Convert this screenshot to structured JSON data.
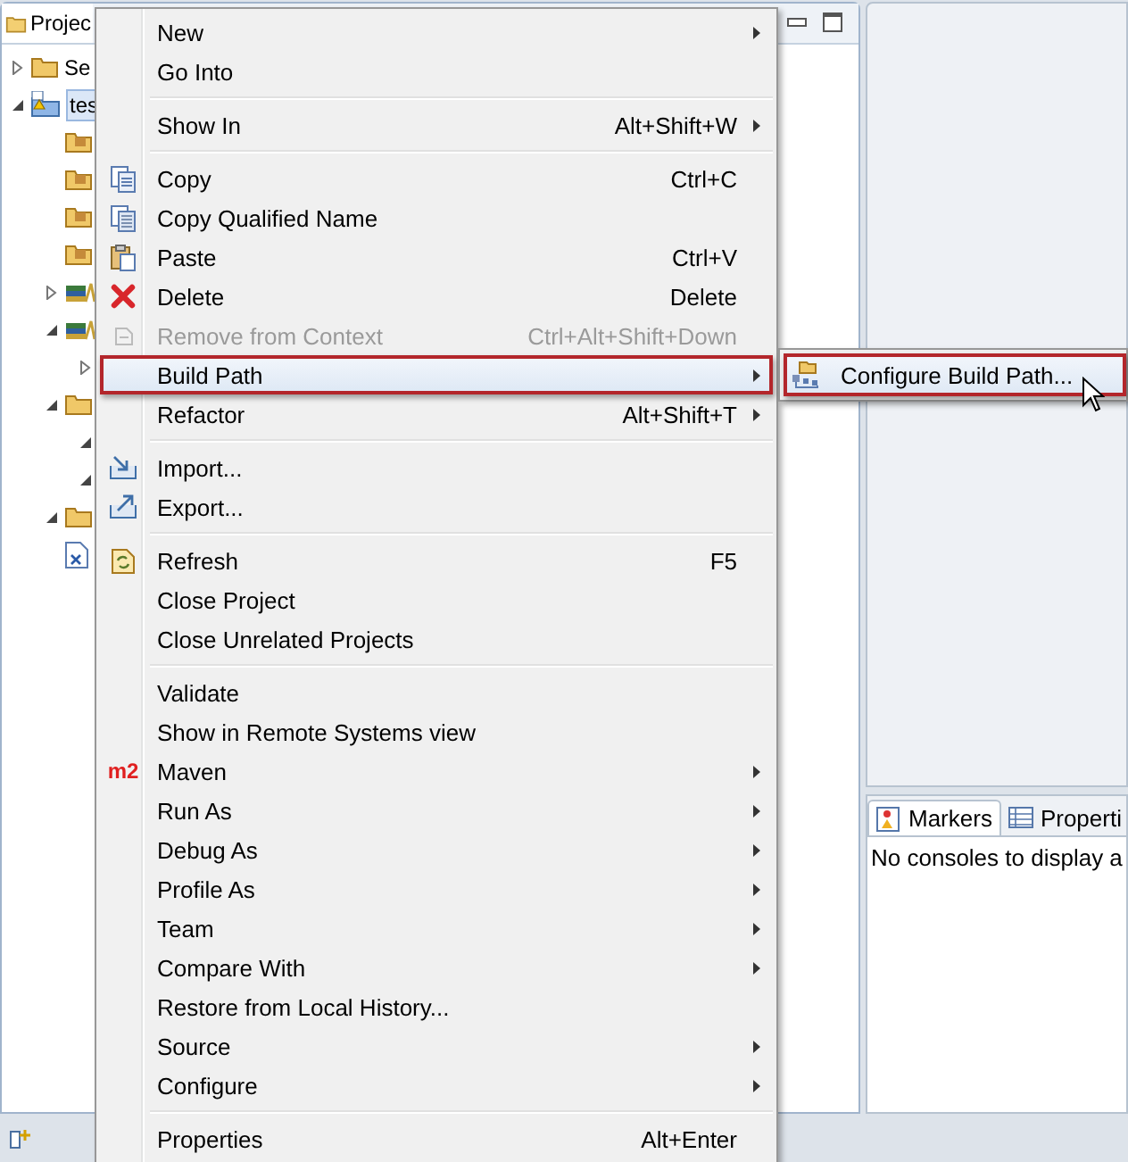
{
  "explorer": {
    "tab": "Projec",
    "tree": [
      {
        "label": "Se",
        "kind": "folder",
        "expanded": false,
        "selected": false
      },
      {
        "label": "tes",
        "kind": "project",
        "expanded": true,
        "selected": true,
        "children": [
          {
            "kind": "package"
          },
          {
            "kind": "package"
          },
          {
            "kind": "package"
          },
          {
            "kind": "package"
          },
          {
            "kind": "library",
            "expanded": false
          },
          {
            "kind": "library",
            "expanded": true,
            "children": [
              {
                "expanded": false
              }
            ]
          },
          {
            "kind": "folder",
            "expanded": true,
            "children": [
              {
                "expanded": true
              },
              {
                "expanded": true
              }
            ]
          },
          {
            "kind": "folder",
            "expanded": true
          },
          {
            "kind": "xml"
          }
        ]
      }
    ]
  },
  "menu": {
    "items": [
      {
        "kind": "item",
        "label": "New",
        "submenu": true,
        "disabled": false,
        "selected": false
      },
      {
        "kind": "item",
        "label": "Go Into",
        "submenu": false,
        "disabled": false,
        "selected": false
      },
      {
        "kind": "separator"
      },
      {
        "kind": "item",
        "label": "Show In",
        "shortcut": "Alt+Shift+W",
        "submenu": true,
        "disabled": false,
        "selected": false
      },
      {
        "kind": "separator"
      },
      {
        "kind": "item",
        "label": "Copy",
        "shortcut": "Ctrl+C",
        "submenu": false,
        "disabled": false,
        "selected": false
      },
      {
        "kind": "item",
        "label": "Copy Qualified Name",
        "submenu": false,
        "disabled": false,
        "selected": false
      },
      {
        "kind": "item",
        "label": "Paste",
        "shortcut": "Ctrl+V",
        "submenu": false,
        "disabled": false,
        "selected": false
      },
      {
        "kind": "item",
        "label": "Delete",
        "shortcut": "Delete",
        "submenu": false,
        "disabled": false,
        "selected": false
      },
      {
        "kind": "item",
        "label": "Remove from Context",
        "shortcut": "Ctrl+Alt+Shift+Down",
        "submenu": false,
        "disabled": true,
        "selected": false
      },
      {
        "kind": "item",
        "label": "Build Path",
        "submenu": true,
        "disabled": false,
        "selected": true
      },
      {
        "kind": "item",
        "label": "Refactor",
        "shortcut": "Alt+Shift+T",
        "submenu": true,
        "disabled": false,
        "selected": false
      },
      {
        "kind": "separator"
      },
      {
        "kind": "item",
        "label": "Import...",
        "submenu": false,
        "disabled": false,
        "selected": false
      },
      {
        "kind": "item",
        "label": "Export...",
        "submenu": false,
        "disabled": false,
        "selected": false
      },
      {
        "kind": "separator"
      },
      {
        "kind": "item",
        "label": "Refresh",
        "shortcut": "F5",
        "submenu": false,
        "disabled": false,
        "selected": false
      },
      {
        "kind": "item",
        "label": "Close Project",
        "submenu": false,
        "disabled": false,
        "selected": false
      },
      {
        "kind": "item",
        "label": "Close Unrelated Projects",
        "submenu": false,
        "disabled": false,
        "selected": false
      },
      {
        "kind": "separator"
      },
      {
        "kind": "item",
        "label": "Validate",
        "submenu": false,
        "disabled": false,
        "selected": false
      },
      {
        "kind": "item",
        "label": "Show in Remote Systems view",
        "submenu": false,
        "disabled": false,
        "selected": false
      },
      {
        "kind": "item",
        "label": "Maven",
        "badge": "m2",
        "submenu": true,
        "disabled": false,
        "selected": false
      },
      {
        "kind": "item",
        "label": "Run As",
        "submenu": true,
        "disabled": false,
        "selected": false
      },
      {
        "kind": "item",
        "label": "Debug As",
        "submenu": true,
        "disabled": false,
        "selected": false
      },
      {
        "kind": "item",
        "label": "Profile As",
        "submenu": true,
        "disabled": false,
        "selected": false
      },
      {
        "kind": "item",
        "label": "Team",
        "submenu": true,
        "disabled": false,
        "selected": false
      },
      {
        "kind": "item",
        "label": "Compare With",
        "submenu": true,
        "disabled": false,
        "selected": false
      },
      {
        "kind": "item",
        "label": "Restore from Local History...",
        "submenu": false,
        "disabled": false,
        "selected": false
      },
      {
        "kind": "item",
        "label": "Source",
        "submenu": true,
        "disabled": false,
        "selected": false
      },
      {
        "kind": "item",
        "label": "Configure",
        "submenu": true,
        "disabled": false,
        "selected": false
      },
      {
        "kind": "separator"
      },
      {
        "kind": "item",
        "label": "Properties",
        "shortcut": "Alt+Enter",
        "submenu": false,
        "disabled": false,
        "selected": false
      }
    ]
  },
  "submenu": {
    "items": [
      {
        "label": "Configure Build Path...",
        "selected": true
      }
    ]
  },
  "console": {
    "tabs": [
      {
        "label": "Markers",
        "selected": true
      },
      {
        "label": "Properti",
        "selected": false
      }
    ],
    "message": "No consoles to display a"
  }
}
